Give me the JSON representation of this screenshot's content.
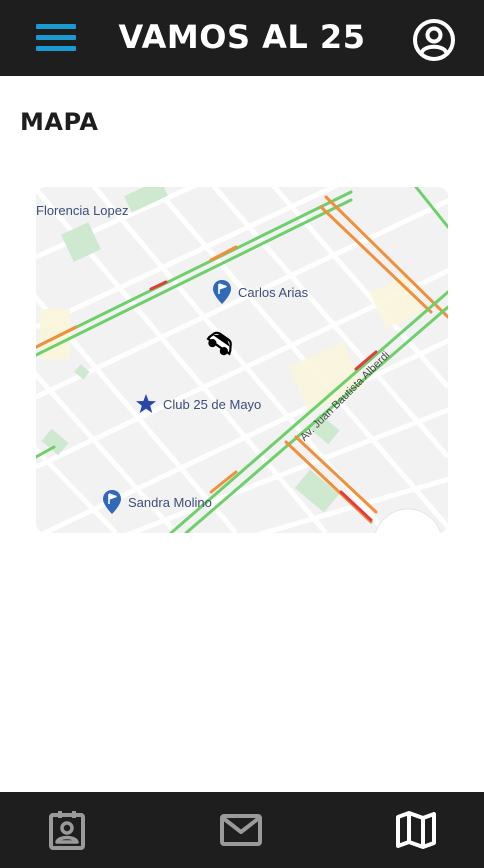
{
  "header": {
    "title": "VAMOS AL 25",
    "menu_icon": "hamburger-menu-icon",
    "profile_icon": "user-circle-icon",
    "accent_color": "#1b9bd1",
    "bar_color": "#1e1e1e"
  },
  "section": {
    "title": "MAPA"
  },
  "map": {
    "labels": {
      "top_left": "Florencia Lopez",
      "street": "Av. Juan Bautista Alberdi"
    },
    "pois": [
      {
        "label": "Carlos Arias",
        "icon": "location-flag-pin-icon"
      },
      {
        "label": "Club 25 de Mayo",
        "icon": "star-icon"
      },
      {
        "label": "Sandra Molino",
        "icon": "location-flag-pin-icon"
      }
    ],
    "vehicle_icon": "car-icon"
  },
  "bottom_nav": {
    "items": [
      {
        "icon": "contact-card-icon"
      },
      {
        "icon": "mail-icon"
      },
      {
        "icon": "map-icon"
      }
    ]
  }
}
